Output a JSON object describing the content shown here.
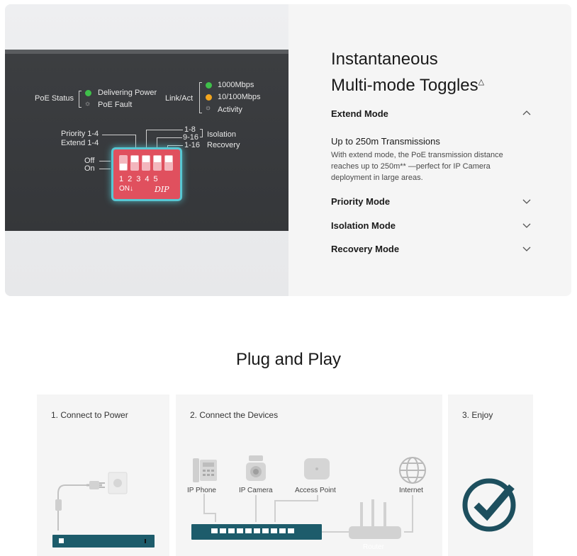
{
  "panel": {
    "poe_status_label": "PoE Status",
    "delivering_power": "Delivering Power",
    "poe_fault": "PoE Fault",
    "link_act_label": "Link/Act",
    "speed_1000": "1000Mbps",
    "speed_10_100": "10/100Mbps",
    "activity": "Activity",
    "priority": "Priority 1-4",
    "extend": "Extend 1-4",
    "range_1_8": "1-8",
    "range_9_16": "9-16",
    "range_1_16": "1-16",
    "isolation": "Isolation",
    "recovery": "Recovery",
    "off": "Off",
    "on": "On",
    "dip_numbers": "12345",
    "dip_on": "ON↓",
    "dip_brand": "DIP",
    "colors": {
      "green_led": "#3fbf4a",
      "orange_led": "#f2a51e",
      "dip": "#e0505e",
      "glow": "#57c7d3"
    }
  },
  "feature": {
    "title_line1": "Instantaneous",
    "title_line2": "Multi-mode Toggles",
    "title_mark": "△",
    "modes": [
      {
        "label": "Extend Mode",
        "expanded": true
      },
      {
        "label": "Priority Mode",
        "expanded": false
      },
      {
        "label": "Isolation Mode",
        "expanded": false
      },
      {
        "label": "Recovery Mode",
        "expanded": false
      }
    ],
    "extend_subtitle": "Up to 250m Transmissions",
    "extend_description": "With extend mode, the PoE transmission distance reaches up to 250m** —perfect for IP Camera deployment in large areas."
  },
  "plug_and_play": {
    "title": "Plug and Play",
    "steps": [
      {
        "label": "1. Connect to Power"
      },
      {
        "label": "2. Connect the Devices"
      },
      {
        "label": "3. Enjoy"
      }
    ],
    "devices": {
      "ip_phone": "IP Phone",
      "ip_camera": "IP Camera",
      "access_point": "Access Point",
      "internet": "Internet",
      "router": "Router"
    },
    "colors": {
      "switch": "#1d5c6b",
      "check": "#1d4f5e"
    }
  }
}
